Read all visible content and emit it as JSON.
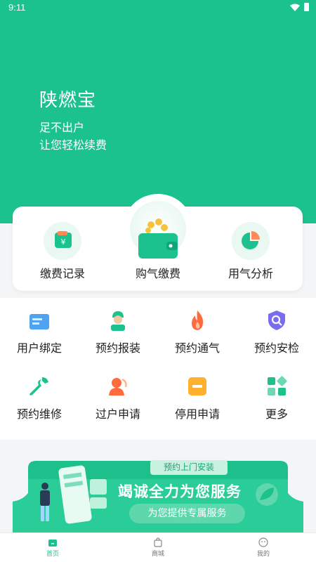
{
  "status_bar": {
    "time": "9:11"
  },
  "hero": {
    "title": "陕燃宝",
    "subtitle_1": "足不出户",
    "subtitle_2": "让您轻松续费"
  },
  "main_card": {
    "items": [
      {
        "label": "缴费记录",
        "icon": "payment-record-icon"
      },
      {
        "label": "购气缴费",
        "icon": "wallet-icon"
      },
      {
        "label": "用气分析",
        "icon": "pie-chart-icon"
      }
    ]
  },
  "services": [
    {
      "label": "用户绑定",
      "icon": "id-card-icon"
    },
    {
      "label": "预约报装",
      "icon": "worker-icon"
    },
    {
      "label": "预约通气",
      "icon": "flame-icon"
    },
    {
      "label": "预约安检",
      "icon": "shield-search-icon"
    },
    {
      "label": "预约维修",
      "icon": "wrench-icon"
    },
    {
      "label": "过户申请",
      "icon": "user-transfer-icon"
    },
    {
      "label": "停用申请",
      "icon": "stop-icon"
    },
    {
      "label": "更多",
      "icon": "grid-more-icon"
    }
  ],
  "banner": {
    "tag": "预约上门安装",
    "title": "竭诚全力为您服务",
    "pill": "为您提供专属服务"
  },
  "tabbar": {
    "tabs": [
      {
        "label": "首页",
        "icon": "home-icon",
        "active": true
      },
      {
        "label": "商城",
        "icon": "shop-bag-icon",
        "active": false
      },
      {
        "label": "我的",
        "icon": "profile-icon",
        "active": false
      }
    ]
  },
  "colors": {
    "brand": "#1cc28e",
    "orange": "#ff6b3d",
    "blue": "#4fa3f0",
    "purple": "#7a6cf0"
  }
}
